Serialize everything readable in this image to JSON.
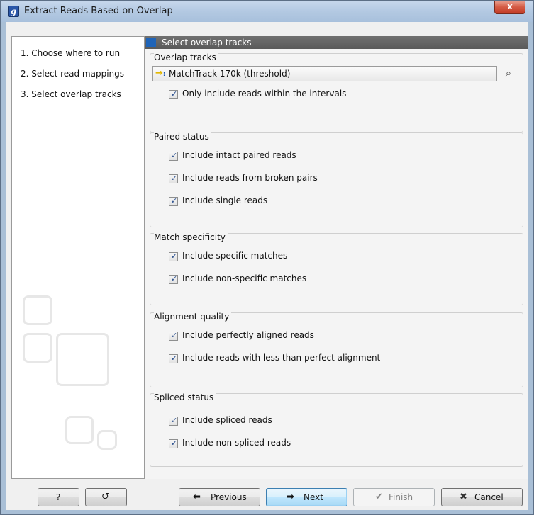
{
  "window": {
    "title": "Extract Reads Based on Overlap",
    "close_glyph": "x",
    "app_icon_letter": "g"
  },
  "steps": [
    "1.  Choose where to run",
    "2.  Select read mappings",
    "3.  Select overlap tracks"
  ],
  "content_header": "Select overlap tracks",
  "groups": {
    "overlap": {
      "title": "Overlap tracks",
      "track_value": "MatchTrack 170k (threshold)",
      "checks": [
        "Only include reads within the intervals"
      ]
    },
    "paired": {
      "title": "Paired status",
      "checks": [
        "Include intact paired reads",
        "Include reads from broken pairs",
        "Include single reads"
      ]
    },
    "match": {
      "title": "Match specificity",
      "checks": [
        "Include specific matches",
        "Include non-specific matches"
      ]
    },
    "alignment": {
      "title": "Alignment quality",
      "checks": [
        "Include perfectly aligned reads",
        "Include reads with less than perfect alignment"
      ]
    },
    "spliced": {
      "title": "Spliced status",
      "checks": [
        "Include spliced reads",
        "Include non spliced reads"
      ]
    }
  },
  "buttons": {
    "help": "?",
    "previous": "Previous",
    "next": "Next",
    "finish": "Finish",
    "cancel": "Cancel"
  },
  "colors": {
    "title_bar": "#b3c9e2",
    "close_button": "#d45a44",
    "header_band": "#5a5a5a",
    "check_mark": "#2a4f8e",
    "default_button": "#bee6fd"
  }
}
